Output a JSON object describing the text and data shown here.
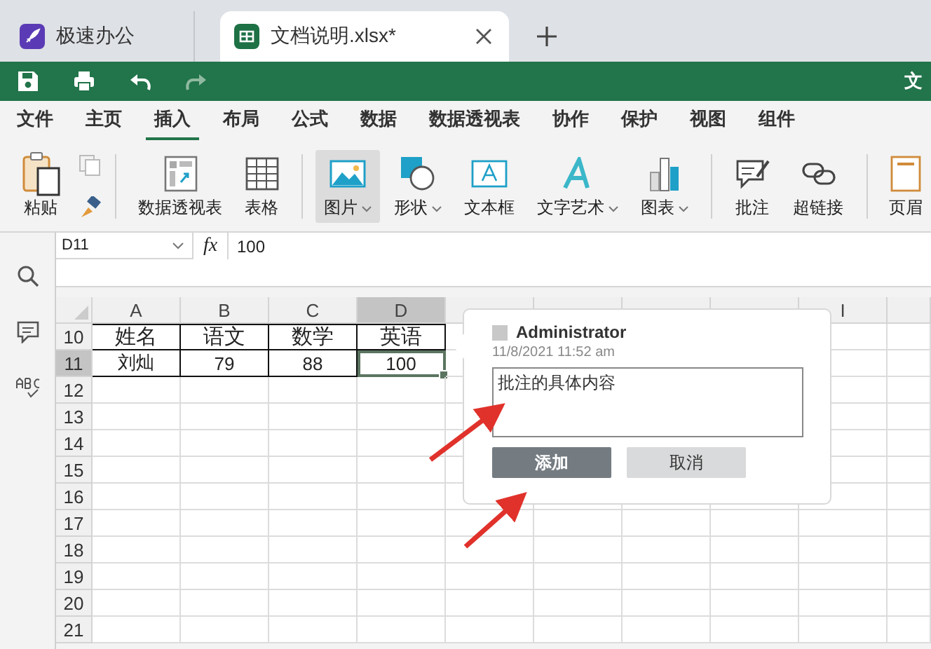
{
  "tabs": [
    {
      "label": "极速办公",
      "kind": "app",
      "selected": false
    },
    {
      "label": "文档说明.xlsx*",
      "kind": "sheet",
      "selected": true
    }
  ],
  "quick_toolbar": {
    "title": "文"
  },
  "menu": [
    {
      "label": "文件",
      "selected": false
    },
    {
      "label": "主页",
      "selected": false
    },
    {
      "label": "插入",
      "selected": true
    },
    {
      "label": "布局",
      "selected": false
    },
    {
      "label": "公式",
      "selected": false
    },
    {
      "label": "数据",
      "selected": false
    },
    {
      "label": "数据透视表",
      "selected": false
    },
    {
      "label": "协作",
      "selected": false
    },
    {
      "label": "保护",
      "selected": false
    },
    {
      "label": "视图",
      "selected": false
    },
    {
      "label": "组件",
      "selected": false
    }
  ],
  "ribbon": [
    [
      {
        "kind": "paste",
        "label": "粘贴",
        "selected": false,
        "dropdown": false
      }
    ],
    [
      {
        "kind": "pivot",
        "label": "数据透视表",
        "selected": false,
        "dropdown": false
      },
      {
        "kind": "table",
        "label": "表格",
        "selected": false,
        "dropdown": false
      }
    ],
    [
      {
        "kind": "picture",
        "label": "图片",
        "selected": true,
        "dropdown": true
      },
      {
        "kind": "shape",
        "label": "形状",
        "selected": false,
        "dropdown": true
      },
      {
        "kind": "textbox",
        "label": "文本框",
        "selected": false,
        "dropdown": false
      },
      {
        "kind": "wordart",
        "label": "文字艺术",
        "selected": false,
        "dropdown": true
      },
      {
        "kind": "chart",
        "label": "图表",
        "selected": false,
        "dropdown": true
      }
    ],
    [
      {
        "kind": "comment",
        "label": "批注",
        "selected": false,
        "dropdown": false
      },
      {
        "kind": "link",
        "label": "超链接",
        "selected": false,
        "dropdown": false
      }
    ],
    [
      {
        "kind": "header",
        "label": "页眉",
        "selected": false,
        "dropdown": false
      }
    ]
  ],
  "formula_bar": {
    "cell_ref": "D11",
    "function_label": "fx",
    "value": "100"
  },
  "sheet": {
    "columns": [
      {
        "label": "A",
        "selected": false
      },
      {
        "label": "B",
        "selected": false
      },
      {
        "label": "C",
        "selected": false
      },
      {
        "label": "D",
        "selected": true
      },
      {
        "selected": false
      },
      {
        "selected": false
      },
      {
        "selected": false
      },
      {
        "selected": false
      },
      {
        "label": "I",
        "selected": false
      }
    ],
    "rows": [
      {
        "number": "10",
        "kind": "header",
        "selected": false,
        "cells": [
          {
            "text": "姓名",
            "selected": false
          },
          {
            "text": "语文",
            "selected": false
          },
          {
            "text": "数学",
            "selected": false
          },
          {
            "text": "英语",
            "selected": false
          }
        ]
      },
      {
        "number": "11",
        "kind": "data",
        "selected": true,
        "cells": [
          {
            "text": "刘灿",
            "selected": false
          },
          {
            "text": "79",
            "selected": false
          },
          {
            "text": "88",
            "selected": false
          },
          {
            "text": "100",
            "selected": true
          }
        ]
      },
      {
        "number": "12",
        "selected": false
      },
      {
        "number": "13",
        "selected": false
      },
      {
        "number": "14",
        "selected": false
      },
      {
        "number": "15",
        "selected": false
      },
      {
        "number": "16",
        "selected": false
      },
      {
        "number": "17",
        "selected": false
      },
      {
        "number": "18",
        "selected": false
      },
      {
        "number": "19",
        "selected": false
      },
      {
        "number": "20",
        "selected": false
      },
      {
        "number": "21",
        "selected": false
      }
    ]
  },
  "comment_popup": {
    "author": "Administrator",
    "timestamp": "11/8/2021 11:52 am",
    "text": "批注的具体内容",
    "buttons": [
      {
        "label": "添加",
        "kind": "primary"
      },
      {
        "label": "取消",
        "kind": "secondary"
      }
    ]
  }
}
